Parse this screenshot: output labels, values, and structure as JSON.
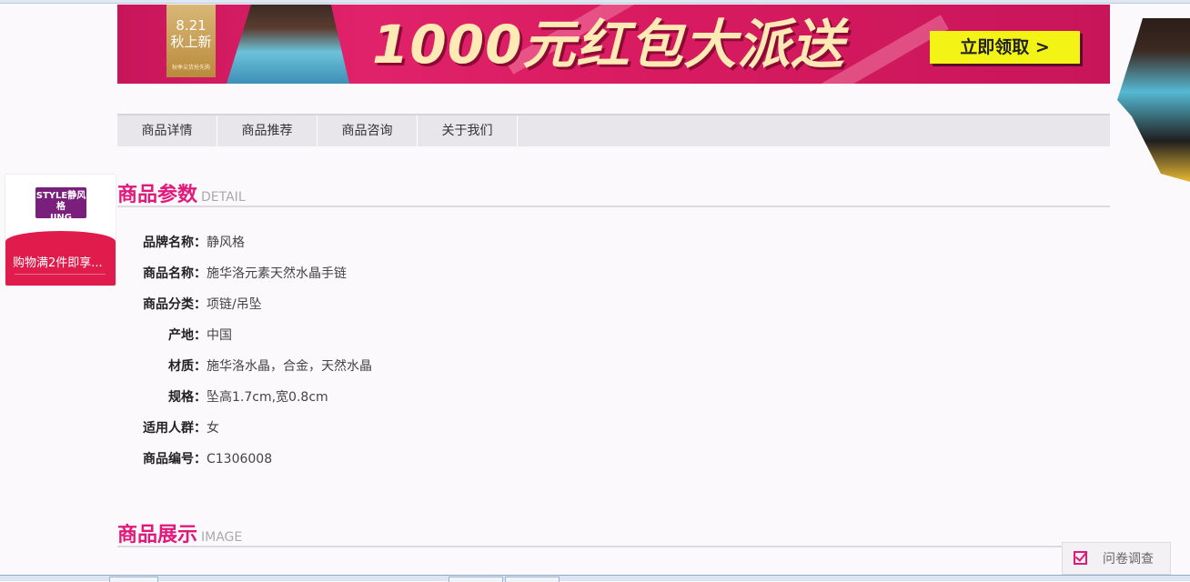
{
  "banner": {
    "date": "8.21",
    "date_sub": "秋上新",
    "date_tag": "秋季尖货抢先购",
    "headline": "1000元红包大派送",
    "cta": "立即领取 >"
  },
  "tabs": [
    {
      "label": "商品详情"
    },
    {
      "label": "商品推荐"
    },
    {
      "label": "商品咨询"
    },
    {
      "label": "关于我们"
    }
  ],
  "shop_card": {
    "logo_top": "STYLE静风格",
    "logo_bottom": "JING",
    "promo": "购物满2件即享..."
  },
  "sections": {
    "detail": {
      "title": "商品参数",
      "subtitle": "DETAIL"
    },
    "image": {
      "title": "商品展示",
      "subtitle": "IMAGE"
    }
  },
  "params": [
    {
      "label": "品牌名称：",
      "value": "静风格"
    },
    {
      "label": "商品名称：",
      "value": "施华洛元素天然水晶手链"
    },
    {
      "label": "商品分类：",
      "value": "项链/吊坠"
    },
    {
      "label": "产地：",
      "value": "中国"
    },
    {
      "label": "材质：",
      "value": "施华洛水晶，合金，天然水晶"
    },
    {
      "label": "规格：",
      "value": "坠高1.7cm,宽0.8cm"
    },
    {
      "label": "适用人群：",
      "value": "女"
    },
    {
      "label": "商品编号：",
      "value": "C1306008"
    }
  ],
  "survey": {
    "label": "问卷调查"
  },
  "colors": {
    "accent": "#e0197a",
    "promo": "#df1c4c",
    "banner": "#d81b60"
  }
}
